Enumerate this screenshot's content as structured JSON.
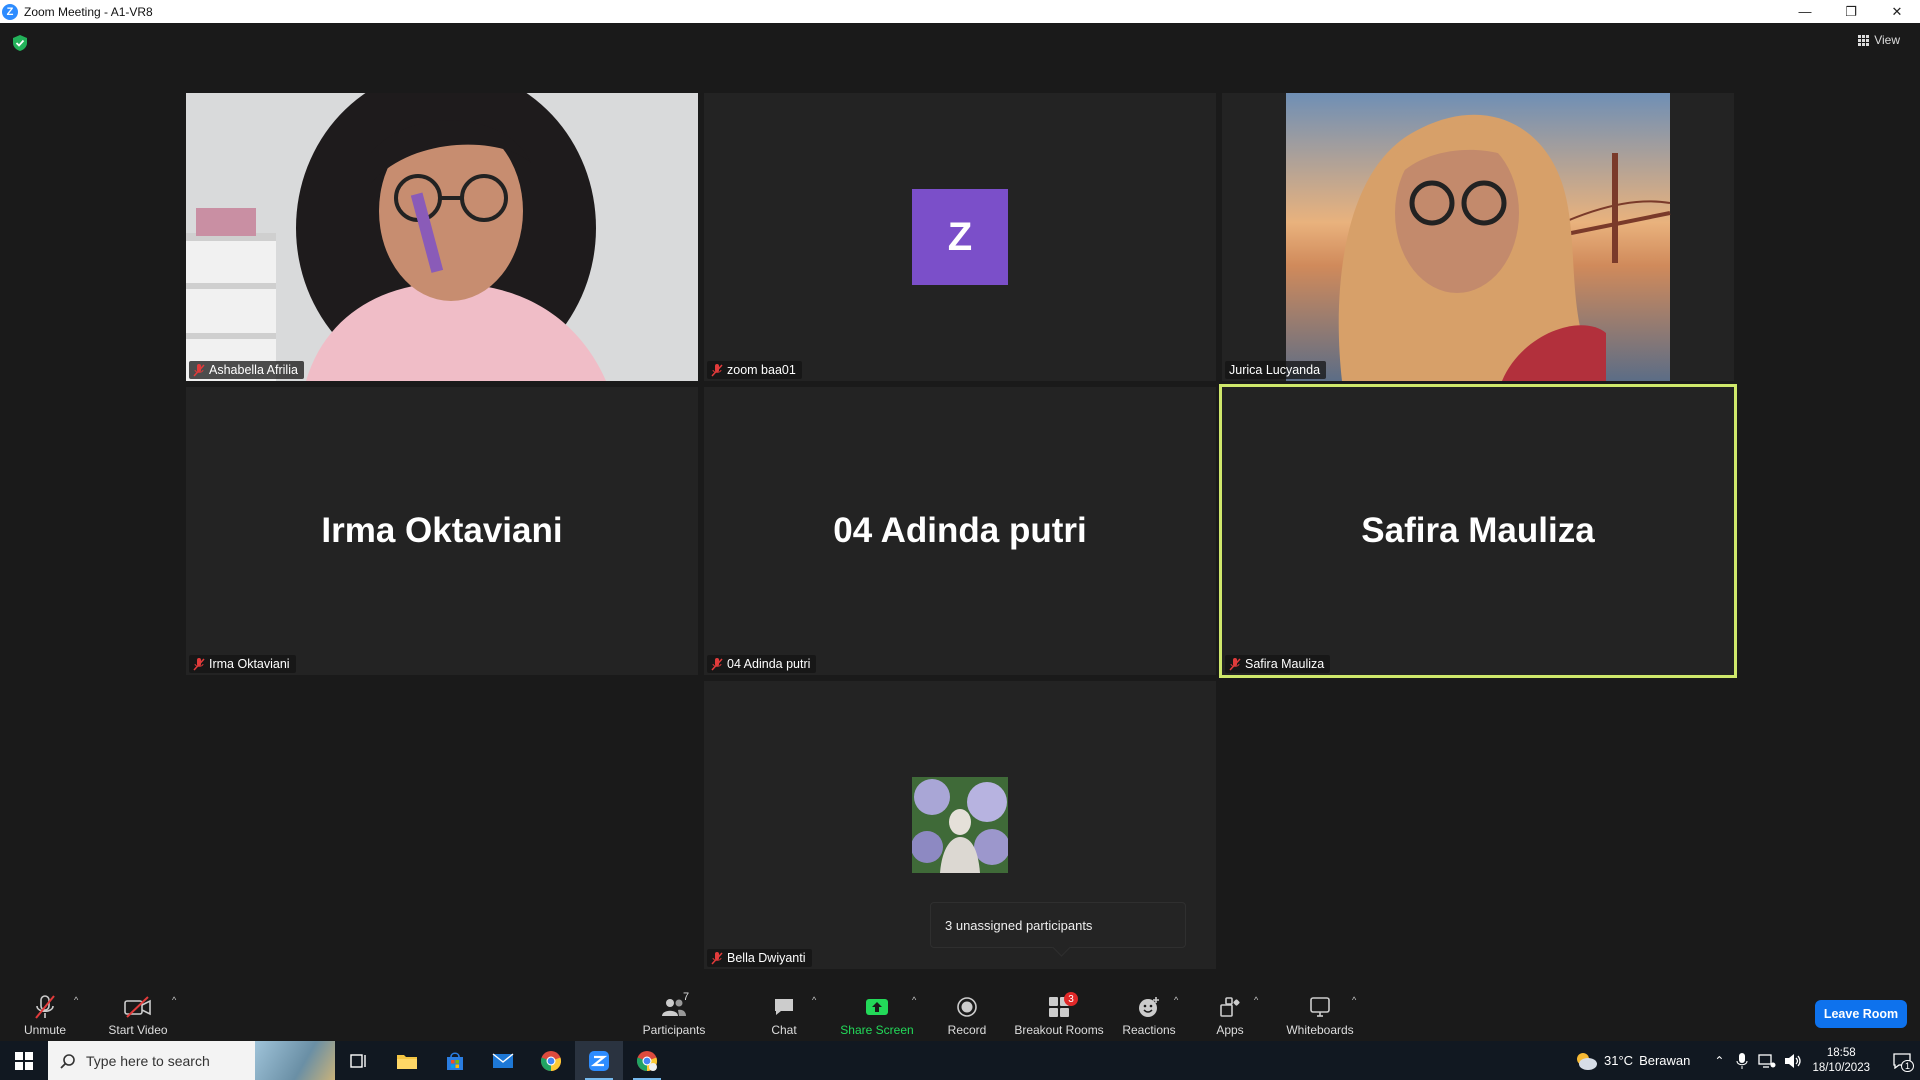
{
  "window": {
    "app_logo": "Z",
    "title": "Zoom Meeting - A1-VR8",
    "minimize": "—",
    "restore": "❐",
    "close": "✕"
  },
  "header": {
    "view_label": "View"
  },
  "tiles": [
    {
      "name": "Ashabella Afrilia",
      "type": "video"
    },
    {
      "name": "zoom baa01",
      "type": "avatar-letter",
      "letter": "Z"
    },
    {
      "name": "Jurica Lucyanda",
      "type": "video"
    },
    {
      "name": "Irma Oktaviani",
      "display_name": "Irma Oktaviani",
      "type": "name"
    },
    {
      "name": "04 Adinda putri",
      "display_name": "04 Adinda putri",
      "type": "name"
    },
    {
      "name": "Safira Mauliza",
      "display_name": "Safira Mauliza",
      "type": "name",
      "active_speaker": true
    },
    {
      "name": "Bella Dwiyanti",
      "type": "avatar-photo"
    }
  ],
  "tooltip": {
    "text": "3 unassigned participants"
  },
  "toolbar": {
    "unmute": "Unmute",
    "start_video": "Start Video",
    "participants": "Participants",
    "participants_count": "7",
    "chat": "Chat",
    "share_screen": "Share Screen",
    "record": "Record",
    "breakout_rooms": "Breakout Rooms",
    "breakout_badge": "3",
    "reactions": "Reactions",
    "apps": "Apps",
    "whiteboards": "Whiteboards",
    "caret": "^",
    "leave_room": "Leave Room"
  },
  "taskbar": {
    "search_placeholder": "Type here to search",
    "weather_temp": "31°C",
    "weather_desc": "Berawan",
    "time": "18:58",
    "date": "18/10/2023",
    "notification_count": "1"
  },
  "colors": {
    "active_speaker_border": "#cfe86b",
    "share_green": "#23d959",
    "leave_blue": "#0e72ed",
    "avatar_purple": "#7b4fc9",
    "badge_red": "#e02828"
  }
}
